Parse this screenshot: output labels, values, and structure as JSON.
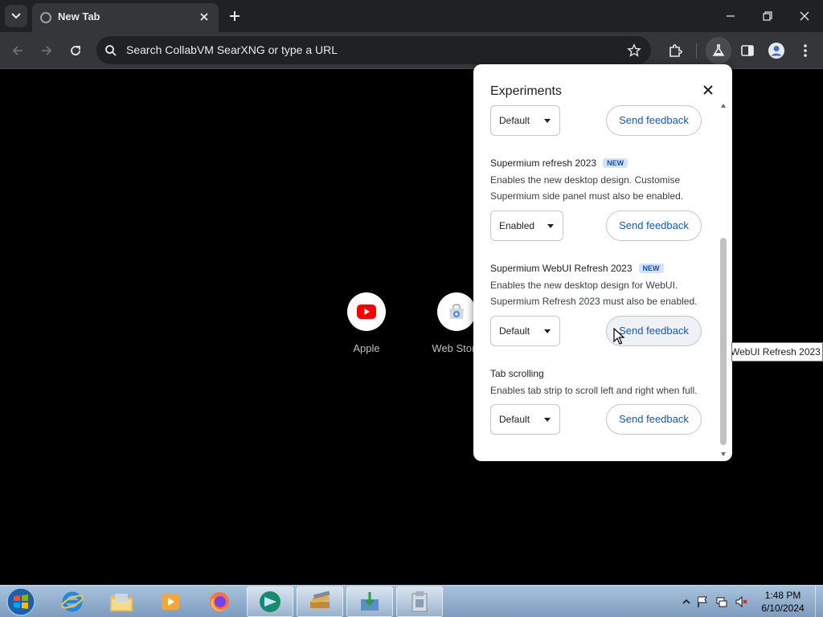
{
  "browser": {
    "tab_title": "New Tab",
    "omnibox_placeholder": "Search CollabVM SearXNG or type a URL"
  },
  "shortcuts": [
    {
      "label": "Apple",
      "icon": "youtube-icon"
    },
    {
      "label": "Web Store",
      "icon": "web-store-icon"
    }
  ],
  "experiments": {
    "title": "Experiments",
    "feedback_label": "Send feedback",
    "items": [
      {
        "name": "",
        "badge": "",
        "desc": "",
        "value": "Default"
      },
      {
        "name": "Supermium refresh 2023",
        "badge": "NEW",
        "desc1": "Enables the new desktop design. Customise",
        "desc2": "Supermium side panel must also be enabled.",
        "value": "Enabled"
      },
      {
        "name": "Supermium WebUI Refresh 2023",
        "badge": "NEW",
        "desc1": "Enables the new desktop design for WebUI.",
        "desc2": "Supermium Refresh 2023 must also be enabled.",
        "value": "Default"
      },
      {
        "name": "Tab scrolling",
        "badge": "",
        "desc1": "Enables tab strip to scroll left and right when full.",
        "value": "Default"
      }
    ]
  },
  "tooltip": "WebUI Refresh 2023",
  "taskbar": {
    "clock_time": "1:48 PM",
    "clock_date": "6/10/2024"
  },
  "colors": {
    "accent": "#0b57d0",
    "badge_bg": "#d3e3fd",
    "browser_frame": "#202124",
    "toolbar": "#35363a"
  }
}
